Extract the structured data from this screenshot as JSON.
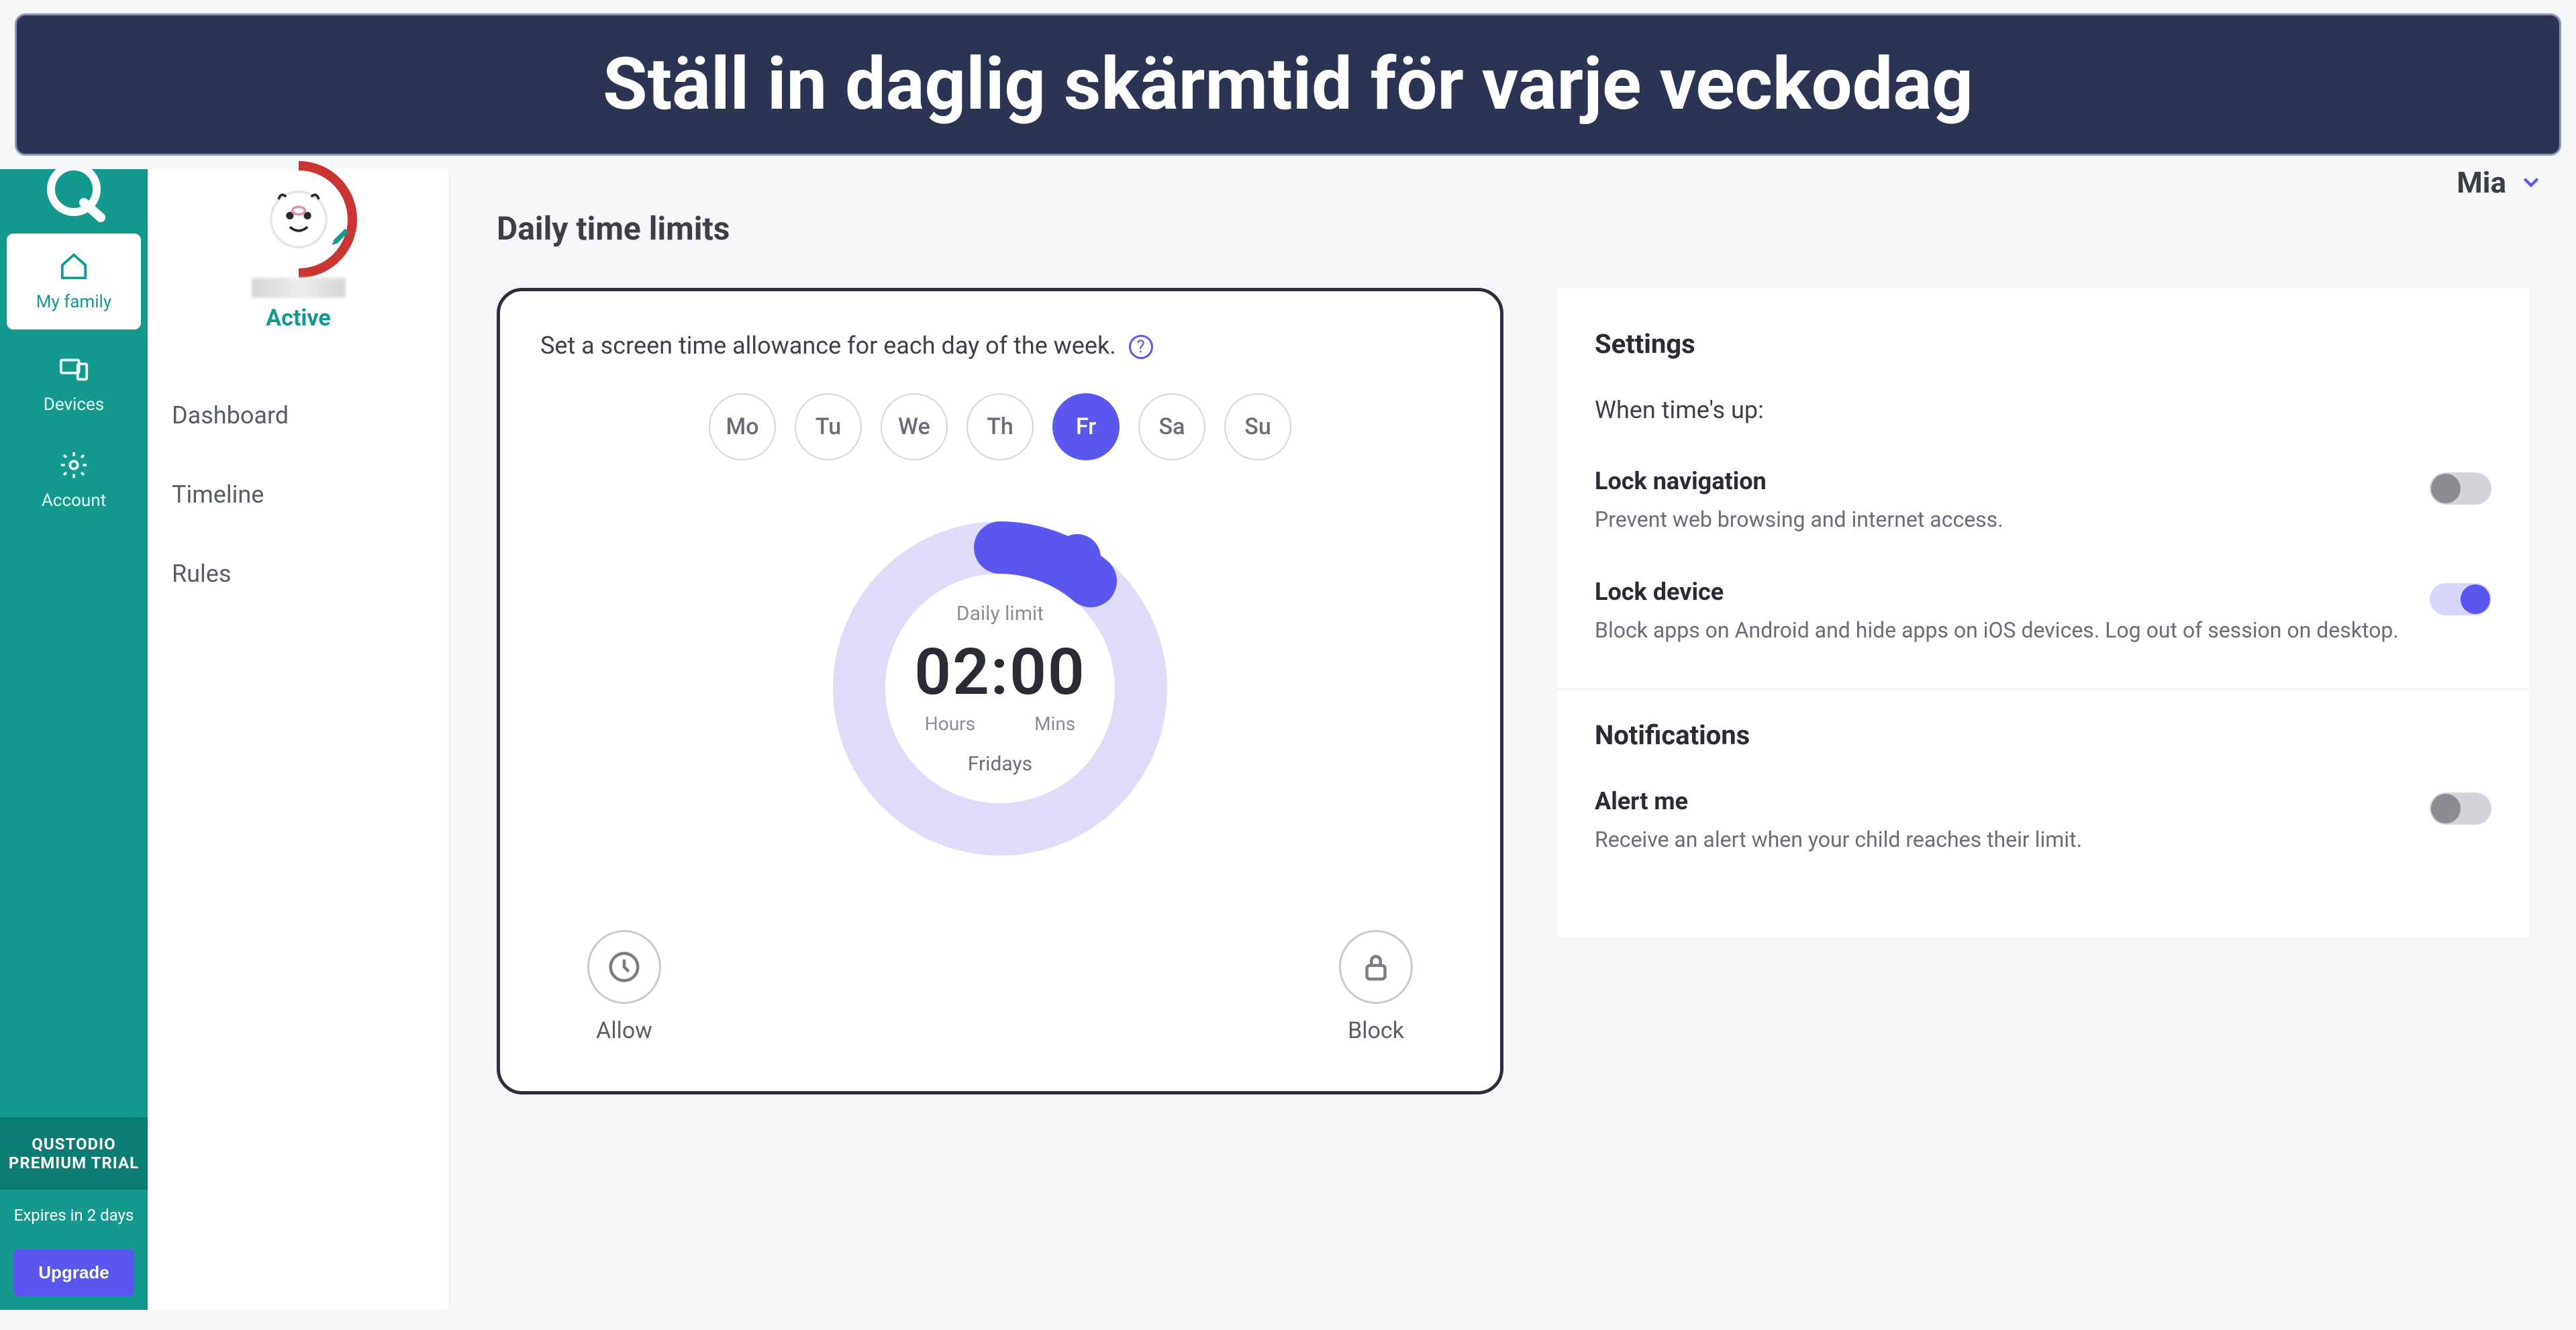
{
  "banner": "Ställ in daglig skärmtid för varje veckodag",
  "sidebar": {
    "items": [
      {
        "label": "My family"
      },
      {
        "label": "Devices"
      },
      {
        "label": "Account"
      }
    ],
    "premium": "QUSTODIO PREMIUM TRIAL",
    "expires": "Expires in 2 days",
    "upgrade": "Upgrade"
  },
  "secondary": {
    "status": "Active",
    "links": [
      "Dashboard",
      "Timeline",
      "Rules"
    ]
  },
  "header": {
    "child": "Mia"
  },
  "page": {
    "title": "Daily time limits",
    "desc": "Set a screen time allowance for each day of the week.",
    "days": [
      "Mo",
      "Tu",
      "We",
      "Th",
      "Fr",
      "Sa",
      "Su"
    ],
    "selected_day_index": 4,
    "dial": {
      "label": "Daily limit",
      "hours": "02",
      "mins": "00",
      "hours_unit": "Hours",
      "mins_unit": "Mins",
      "day_label": "Fridays"
    },
    "actions": {
      "allow": "Allow",
      "block": "Block"
    }
  },
  "settings": {
    "title": "Settings",
    "when": "When time's up:",
    "lock_nav": {
      "title": "Lock navigation",
      "desc": "Prevent web browsing and internet access.",
      "on": false
    },
    "lock_device": {
      "title": "Lock device",
      "desc": "Block apps on Android and hide apps on iOS devices. Log out of session on desktop.",
      "on": true
    },
    "notifications_title": "Notifications",
    "alert": {
      "title": "Alert me",
      "desc": "Receive an alert when your child reaches their limit.",
      "on": false
    }
  }
}
